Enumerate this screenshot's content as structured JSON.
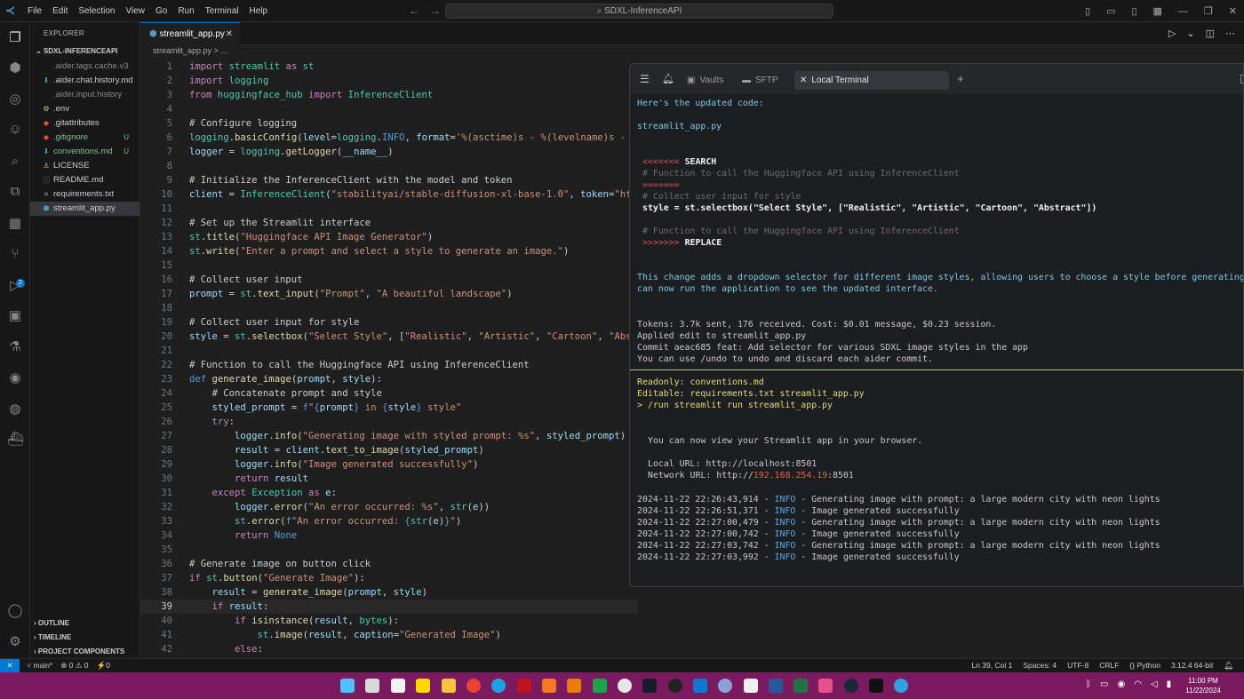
{
  "titlebar": {
    "menus": [
      "File",
      "Edit",
      "Selection",
      "View",
      "Go",
      "Run",
      "Terminal",
      "Help"
    ],
    "search": "SDXL-InferenceAPI"
  },
  "sidebar": {
    "header": "EXPLORER",
    "root": "SDXL-INFERENCEAPI",
    "files": [
      {
        "name": ".aider.tags.cache.v3",
        "status": ""
      },
      {
        "name": ".aider.chat.history.md",
        "status": ""
      },
      {
        "name": ".aider.input.history",
        "status": ""
      },
      {
        "name": ".env",
        "status": ""
      },
      {
        "name": ".gitattributes",
        "status": ""
      },
      {
        "name": ".gitignore",
        "status": "U"
      },
      {
        "name": "conventions.md",
        "status": "U"
      },
      {
        "name": "LICENSE",
        "status": ""
      },
      {
        "name": "README.md",
        "status": ""
      },
      {
        "name": "requirements.txt",
        "status": ""
      },
      {
        "name": "streamlit_app.py",
        "status": ""
      }
    ],
    "sections": [
      "OUTLINE",
      "TIMELINE",
      "PROJECT COMPONENTS"
    ]
  },
  "editor": {
    "tab": "streamlit_app.py",
    "breadcrumb": "streamlit_app.py > ..."
  },
  "terminal": {
    "tabs": [
      "Vaults",
      "SFTP",
      "Local Terminal"
    ],
    "lines": {
      "l1": "Here's the updated code:",
      "l2": "streamlit_app.py",
      "l3a": "<<<<<<< ",
      "l3b": "SEARCH",
      "l4": "# Function to call the Huggingface API using InferenceClient",
      "l5": "=======",
      "l6": "# Collect user input for style",
      "l7": "style = st.selectbox(\"Select Style\", [\"Realistic\", \"Artistic\", \"Cartoon\", \"Abstract\"])",
      "l8": "# Function to call the Huggingface API using InferenceClient",
      "l9a": ">>>>>>> ",
      "l9b": "REPLACE",
      "l10": "This change adds a dropdown selector for different image styles, allowing users to choose a style before generating an",
      "l11": "can now run the application to see the updated interface.",
      "l12": "Tokens: 3.7k sent, 176 received. Cost: $0.01 message, $0.23 session.",
      "l13": "Applied edit to streamlit_app.py",
      "l14": "Commit aeac685 feat: Add selector for various SDXL image styles in the app",
      "l15": "You can use /undo to undo and discard each aider commit.",
      "l16": "Readonly: conventions.md",
      "l17": "Editable: requirements.txt streamlit_app.py",
      "l18": "> /run streamlit run streamlit_app.py",
      "l19": "You can now view your Streamlit app in your browser.",
      "l20": "Local URL: http://localhost:8501",
      "l21a": "Network URL: http://",
      "l21b": "192.168.254.19",
      "l21c": ":8501",
      "logs": [
        {
          "ts": "2024-11-22 22:26:43,914 - ",
          "lvl": "INFO",
          "msg": " - Generating image with prompt: a large modern city with neon lights"
        },
        {
          "ts": "2024-11-22 22:26:51,371 - ",
          "lvl": "INFO",
          "msg": " - Image generated successfully"
        },
        {
          "ts": "2024-11-22 22:27:00,479 - ",
          "lvl": "INFO",
          "msg": " - Generating image with prompt: a large modern city with neon lights"
        },
        {
          "ts": "2024-11-22 22:27:00,742 - ",
          "lvl": "INFO",
          "msg": " - Image generated successfully"
        },
        {
          "ts": "2024-11-22 22:27:03,742 - ",
          "lvl": "INFO",
          "msg": " - Generating image with prompt: a large modern city with neon lights"
        },
        {
          "ts": "2024-11-22 22:27:03,992 - ",
          "lvl": "INFO",
          "msg": " - Image generated successfully"
        }
      ]
    }
  },
  "statusbar": {
    "branch": "main*",
    "problems": "⊗ 0 ⚠ 0",
    "ports": "⚡0",
    "position": "Ln 39, Col 1",
    "spaces": "Spaces: 4",
    "encoding": "UTF-8",
    "eol": "CRLF",
    "language": "Python",
    "interpreter": "3.12.4 64-bit"
  },
  "taskbar": {
    "time": "11:00 PM",
    "date": "11/22/2024"
  },
  "colors": {
    "accent": "#0078d4",
    "taskbar": "#7b1a5f",
    "terminal_sep": "#a6c98a"
  }
}
